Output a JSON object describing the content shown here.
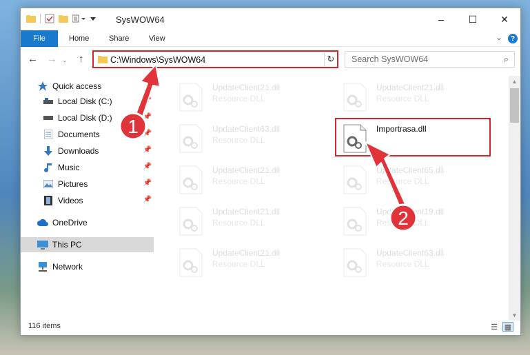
{
  "window": {
    "title": "SysWOW64",
    "controls": {
      "minimize": "–",
      "maximize": "☐",
      "close": "✕"
    }
  },
  "ribbon": {
    "file_tab": "File",
    "tabs": [
      "Home",
      "Share",
      "View"
    ],
    "help": "?"
  },
  "navigation": {
    "address_path": "C:\\Windows\\SysWOW64",
    "search_placeholder": "Search SysWOW64"
  },
  "sidebar": {
    "items": [
      {
        "label": "Quick access",
        "icon": "star-icon",
        "pinned": false
      },
      {
        "label": "Local Disk (C:)",
        "icon": "drive-icon",
        "pinned": true
      },
      {
        "label": "Local Disk (D:)",
        "icon": "drive-icon",
        "pinned": true
      },
      {
        "label": "Documents",
        "icon": "documents-icon",
        "pinned": true
      },
      {
        "label": "Downloads",
        "icon": "download-icon",
        "pinned": true
      },
      {
        "label": "Music",
        "icon": "music-icon",
        "pinned": true
      },
      {
        "label": "Pictures",
        "icon": "pictures-icon",
        "pinned": true
      },
      {
        "label": "Videos",
        "icon": "videos-icon",
        "pinned": true
      },
      {
        "label": "OneDrive",
        "icon": "cloud-icon",
        "pinned": false
      },
      {
        "label": "This PC",
        "icon": "computer-icon",
        "pinned": false,
        "selected": true
      },
      {
        "label": "Network",
        "icon": "network-icon",
        "pinned": false
      }
    ]
  },
  "files": [
    {
      "name": "UpdateClient21.dll",
      "type": "Resource DLL",
      "highlighted": false
    },
    {
      "name": "UpdateClient21.dll",
      "type": "Resource DLL",
      "highlighted": false
    },
    {
      "name": "UpdateClient63.dll",
      "type": "Resource DLL",
      "highlighted": false
    },
    {
      "name": "Importrasa.dll",
      "type": "",
      "highlighted": true
    },
    {
      "name": "UpdateClient21.dll",
      "type": "Resource DLL",
      "highlighted": false
    },
    {
      "name": "UpdateClient65.dll",
      "type": "Resource DLL",
      "highlighted": false
    },
    {
      "name": "UpdateClient21.dll",
      "type": "Resource DLL",
      "highlighted": false
    },
    {
      "name": "UpdateClient19.dll",
      "type": "Resource DLL",
      "highlighted": false
    },
    {
      "name": "UpdateClient21.dll",
      "type": "Resource DLL",
      "highlighted": false
    },
    {
      "name": "UpdateClient63.dll",
      "type": "Resource DLL",
      "highlighted": false
    }
  ],
  "status": {
    "item_count": "116 items"
  },
  "annotations": {
    "step1": "1",
    "step2": "2",
    "highlight_color": "#d8232a",
    "badge_color": "#e0343a"
  }
}
